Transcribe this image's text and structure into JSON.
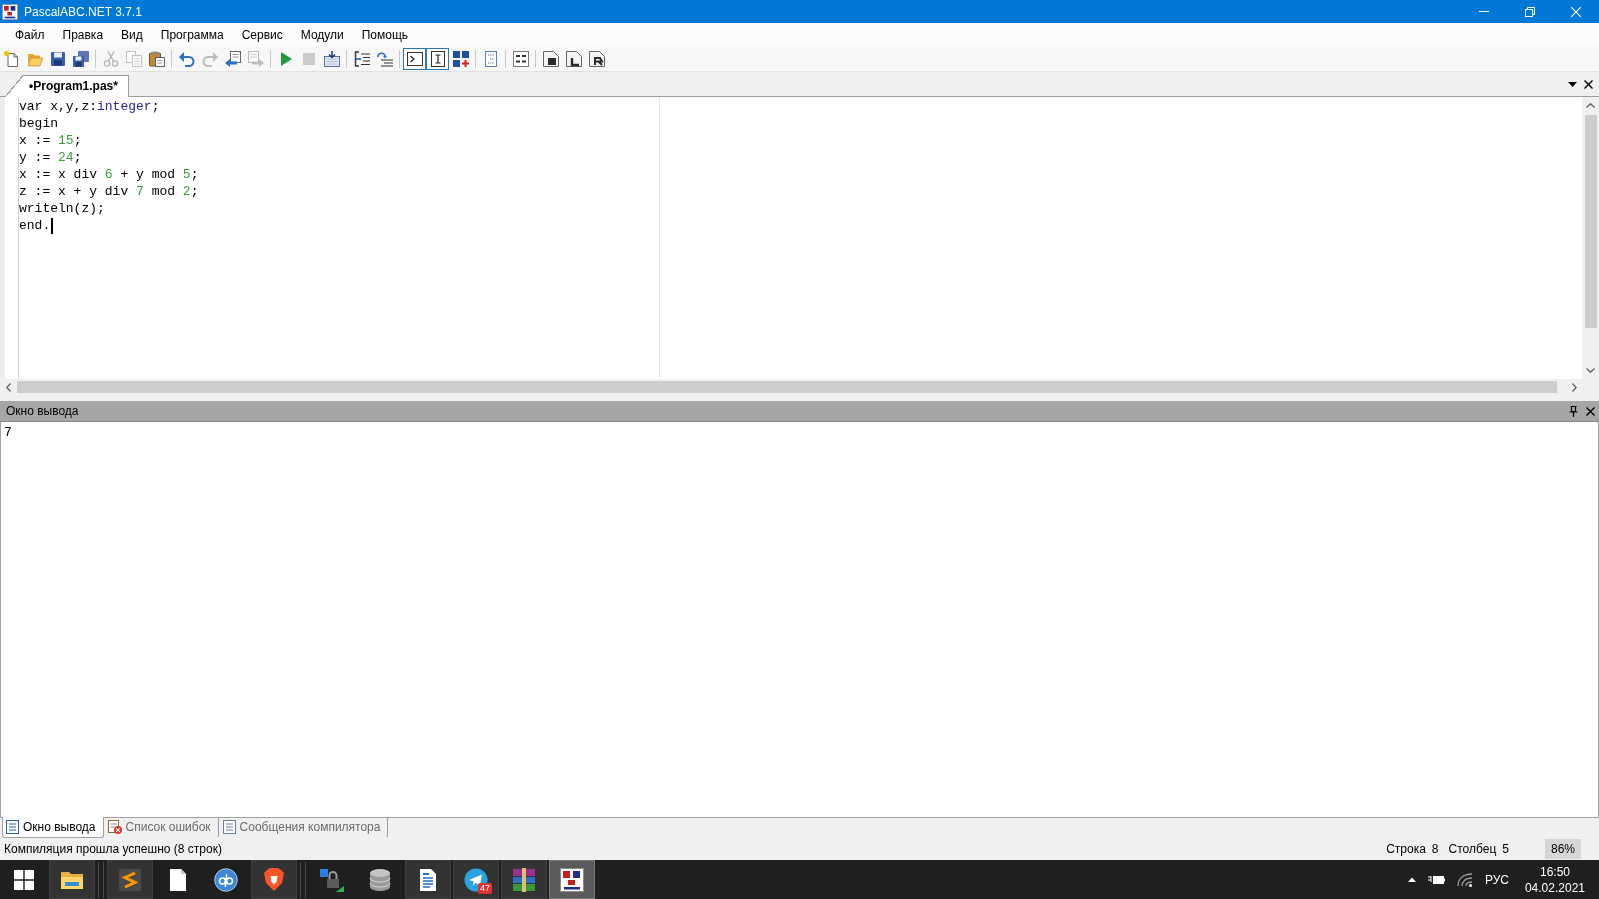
{
  "window": {
    "title": "PascalABC.NET 3.7.1"
  },
  "menu": [
    "Файл",
    "Правка",
    "Вид",
    "Программа",
    "Сервис",
    "Модули",
    "Помощь"
  ],
  "toolbar": [
    [
      {
        "kind": "new",
        "disabled": false,
        "pressed": false
      },
      {
        "kind": "open",
        "disabled": false,
        "pressed": false
      },
      {
        "kind": "save",
        "disabled": false,
        "pressed": false
      },
      {
        "kind": "save_all",
        "disabled": false,
        "pressed": false
      }
    ],
    [
      {
        "kind": "cut",
        "disabled": true,
        "pressed": false
      },
      {
        "kind": "copy",
        "disabled": true,
        "pressed": false
      },
      {
        "kind": "paste",
        "disabled": false,
        "pressed": false
      }
    ],
    [
      {
        "kind": "undo",
        "disabled": false,
        "pressed": false
      },
      {
        "kind": "redo",
        "disabled": true,
        "pressed": false
      },
      {
        "kind": "back",
        "disabled": false,
        "pressed": false
      },
      {
        "kind": "forward",
        "disabled": true,
        "pressed": false
      }
    ],
    [
      {
        "kind": "run",
        "disabled": false,
        "pressed": false
      },
      {
        "kind": "stop",
        "disabled": true,
        "pressed": false
      },
      {
        "kind": "compile",
        "disabled": false,
        "pressed": false
      }
    ],
    [
      {
        "kind": "step_into",
        "disabled": false,
        "pressed": false
      },
      {
        "kind": "step_over",
        "disabled": false,
        "pressed": false
      }
    ],
    [
      {
        "kind": "console",
        "disabled": false,
        "pressed": true
      },
      {
        "kind": "cursor",
        "disabled": false,
        "pressed": true
      },
      {
        "kind": "spell",
        "disabled": false,
        "pressed": false
      }
    ],
    [
      {
        "kind": "format",
        "disabled": false,
        "pressed": false
      }
    ],
    [
      {
        "kind": "code",
        "disabled": false,
        "pressed": false
      }
    ],
    [
      {
        "kind": "page_d",
        "disabled": false,
        "pressed": false
      },
      {
        "kind": "page_l",
        "disabled": false,
        "pressed": false
      },
      {
        "kind": "page_r",
        "disabled": false,
        "pressed": false
      }
    ]
  ],
  "document_tabs": [
    {
      "label": "•Program1.pas*",
      "selected": true
    }
  ],
  "editor": {
    "lines": [
      {
        "cursor": false,
        "tokens": [
          {
            "kind": "text",
            "text": "var x,y,z:"
          },
          {
            "kind": "type",
            "text": "integer"
          },
          {
            "kind": "text",
            "text": ";"
          }
        ]
      },
      {
        "cursor": false,
        "tokens": [
          {
            "kind": "text",
            "text": "begin"
          }
        ]
      },
      {
        "cursor": false,
        "tokens": [
          {
            "kind": "text",
            "text": "x := "
          },
          {
            "kind": "number",
            "text": "15"
          },
          {
            "kind": "text",
            "text": ";"
          }
        ]
      },
      {
        "cursor": false,
        "tokens": [
          {
            "kind": "text",
            "text": "y := "
          },
          {
            "kind": "number",
            "text": "24"
          },
          {
            "kind": "text",
            "text": ";"
          }
        ]
      },
      {
        "cursor": false,
        "tokens": [
          {
            "kind": "text",
            "text": "x := x div "
          },
          {
            "kind": "number",
            "text": "6"
          },
          {
            "kind": "text",
            "text": " + y mod "
          },
          {
            "kind": "number",
            "text": "5"
          },
          {
            "kind": "text",
            "text": ";"
          }
        ]
      },
      {
        "cursor": false,
        "tokens": [
          {
            "kind": "text",
            "text": "z := x + y div "
          },
          {
            "kind": "number",
            "text": "7"
          },
          {
            "kind": "text",
            "text": " mod "
          },
          {
            "kind": "number",
            "text": "2"
          },
          {
            "kind": "text",
            "text": ";"
          }
        ]
      },
      {
        "cursor": false,
        "tokens": [
          {
            "kind": "text",
            "text": "writeln(z);"
          }
        ]
      },
      {
        "cursor": true,
        "tokens": [
          {
            "kind": "text",
            "text": "end."
          }
        ]
      }
    ]
  },
  "output_panel": {
    "title": "Окно вывода",
    "lines": [
      "7"
    ]
  },
  "bottom_tabs": [
    {
      "kind": "output",
      "label": "Окно вывода",
      "selected": true
    },
    {
      "kind": "errors",
      "label": "Список ошибок",
      "selected": false
    },
    {
      "kind": "messages",
      "label": "Сообщения компилятора",
      "selected": false
    }
  ],
  "status_bar": {
    "message": "Компиляция прошла успешно (8 строк)",
    "position": [
      {
        "label": "Строка",
        "value": "8"
      },
      {
        "label": "Столбец",
        "value": "5"
      }
    ],
    "zoom": "86%"
  },
  "taskbar": {
    "groups": [
      [
        {
          "kind": "explorer",
          "open": true,
          "selected": false
        }
      ],
      [
        {
          "kind": "sublime",
          "open": true,
          "selected": false
        },
        {
          "kind": "blank_doc",
          "open": false,
          "selected": false
        },
        {
          "kind": "qb",
          "open": false,
          "selected": false
        },
        {
          "kind": "shield",
          "open": true,
          "selected": false
        }
      ],
      [
        {
          "kind": "lock",
          "open": false,
          "selected": false
        },
        {
          "kind": "database",
          "open": false,
          "selected": false
        },
        {
          "kind": "writer",
          "open": true,
          "selected": false
        },
        {
          "kind": "telegram",
          "open": true,
          "selected": false,
          "badge": "47"
        },
        {
          "kind": "books",
          "open": true,
          "selected": false
        },
        {
          "kind": "pascal",
          "open": true,
          "selected": true
        }
      ]
    ],
    "tray": {
      "language": "РУС",
      "time": "16:50",
      "date": "04.02.2021"
    }
  }
}
